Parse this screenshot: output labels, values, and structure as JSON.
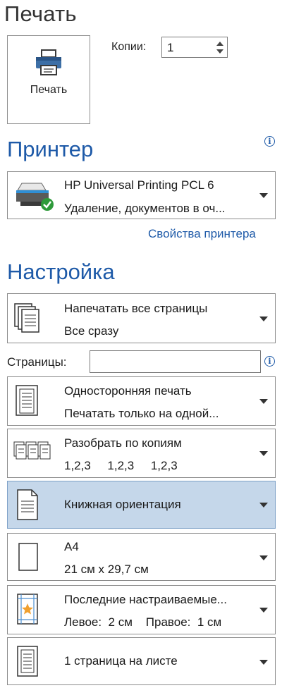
{
  "print_section": {
    "title": "Печать",
    "print_button_label": "Печать",
    "copies_label": "Копии:",
    "copies_value": "1"
  },
  "printer_section": {
    "title": "Принтер",
    "printer_name": "HP Universal Printing PCL 6",
    "printer_status": "Удаление, документов в оч...",
    "properties_link": "Свойства принтера"
  },
  "settings_section": {
    "title": "Настройка",
    "pages_label": "Страницы:",
    "pages_value": "",
    "options": [
      {
        "line1": "Напечатать все страницы",
        "line2": "Все сразу",
        "icon": "print-all-pages-icon"
      },
      {
        "line1": "Односторонняя печать",
        "line2": "Печатать только на одной...",
        "icon": "one-sided-icon"
      },
      {
        "line1": "Разобрать по копиям",
        "line2": "1,2,3     1,2,3     1,2,3",
        "icon": "collate-icon"
      },
      {
        "line1": "Книжная ориентация",
        "line2": "",
        "icon": "portrait-orientation-icon"
      },
      {
        "line1": "A4",
        "line2": "21 см х 29,7 см",
        "icon": "paper-size-icon"
      },
      {
        "line1": "Последние настраиваемые...",
        "line2": "Левое:  2 см    Правое:  1 см",
        "icon": "margins-icon"
      },
      {
        "line1": "1 страница на листе",
        "line2": "",
        "icon": "pages-per-sheet-icon"
      }
    ]
  },
  "colors": {
    "accent": "#1e5aa8",
    "selected_background": "#c5d7ea"
  }
}
